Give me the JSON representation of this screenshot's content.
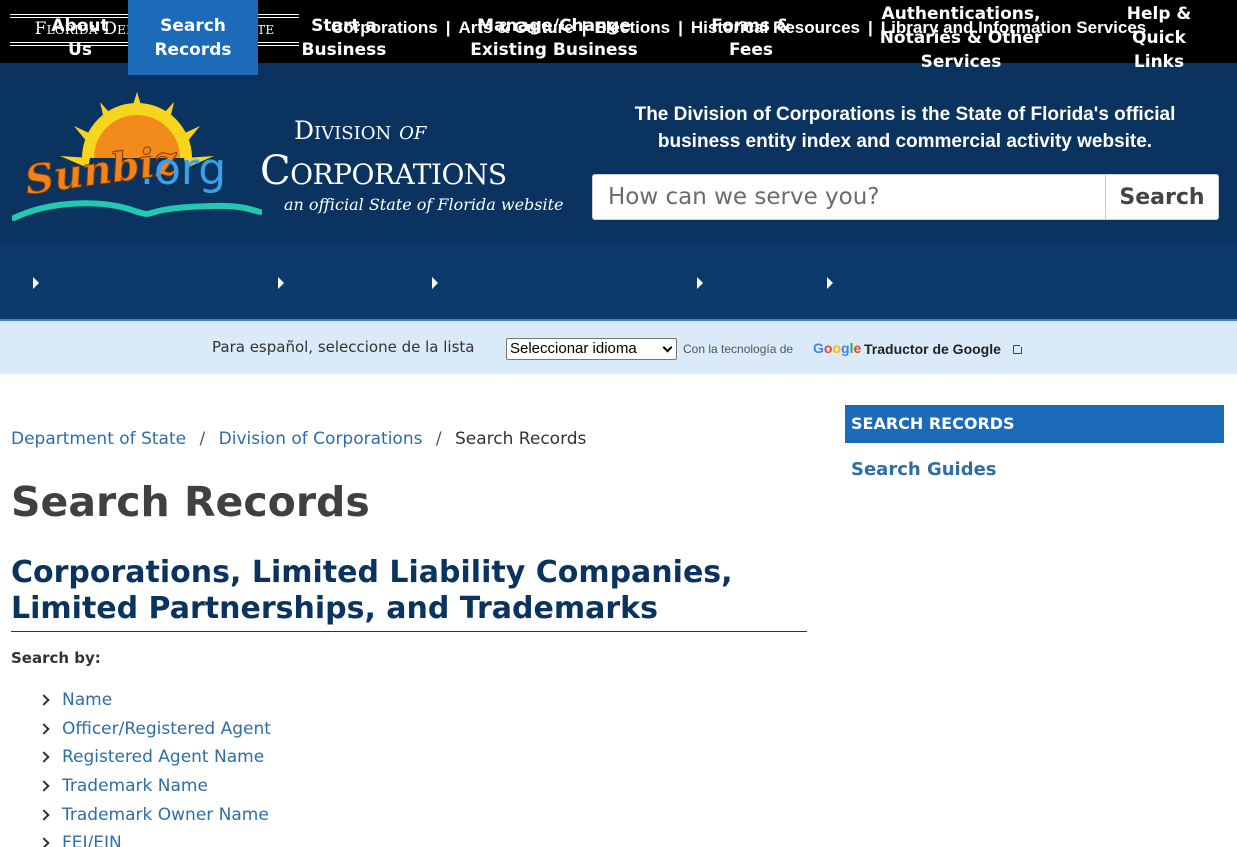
{
  "topbar": {
    "dos_logo": {
      "prefix": "Florida Department ",
      "of": "of",
      "suffix": " State"
    },
    "links": [
      "Corporations",
      "Arts & Culture",
      "Elections",
      "Historical Resources",
      "Library and Information Services"
    ],
    "separator": "|"
  },
  "header": {
    "sunbiz_logo": {
      "sunbiz": "Sunbiz",
      "org": ".org"
    },
    "division": {
      "line1_prefix": "Division ",
      "line1_of": "of",
      "line2": "Corporations",
      "line3": "an official State of Florida website"
    },
    "tagline": "The Division of Corporations is the State of Florida's official business entity index and commercial activity website.",
    "search": {
      "placeholder": "How can we serve you?",
      "button": "Search"
    }
  },
  "mainnav": {
    "items": [
      {
        "label": "About Us"
      },
      {
        "label": "Search Records",
        "active": true
      },
      {
        "label": "Start a Business"
      },
      {
        "label": "Manage/Change Existing Business"
      },
      {
        "label": "Forms & Fees"
      },
      {
        "label": "Authentications, Notaries & Other Services"
      },
      {
        "label": "Help & Quick Links"
      }
    ]
  },
  "translate": {
    "label": "Para español, seleccione de la lista",
    "select_value": "Seleccionar idioma",
    "powered_by": "Con la tecnología de",
    "google": "Google",
    "link": "Traductor de Google"
  },
  "breadcrumb": {
    "items": [
      "Department of State",
      "Division of Corporations"
    ],
    "current": "Search Records",
    "separator": "/"
  },
  "main": {
    "page_title": "Search Records",
    "section_title": "Corporations, Limited Liability Companies, Limited Partnerships, and Trademarks",
    "search_by_label": "Search by:",
    "links": [
      "Name",
      "Officer/Registered Agent",
      "Registered Agent Name",
      "Trademark Name",
      "Trademark Owner Name",
      "FEI/EIN"
    ]
  },
  "sidebar": {
    "heading": "SEARCH RECORDS",
    "link": "Search Guides"
  },
  "colors": {
    "topbar": "#000000",
    "header": "#0b3360",
    "nav": "#0b3a6a",
    "nav_active": "#1b6bb8",
    "translate_bar": "#dbeaf8",
    "link": "#2d6ea7"
  }
}
